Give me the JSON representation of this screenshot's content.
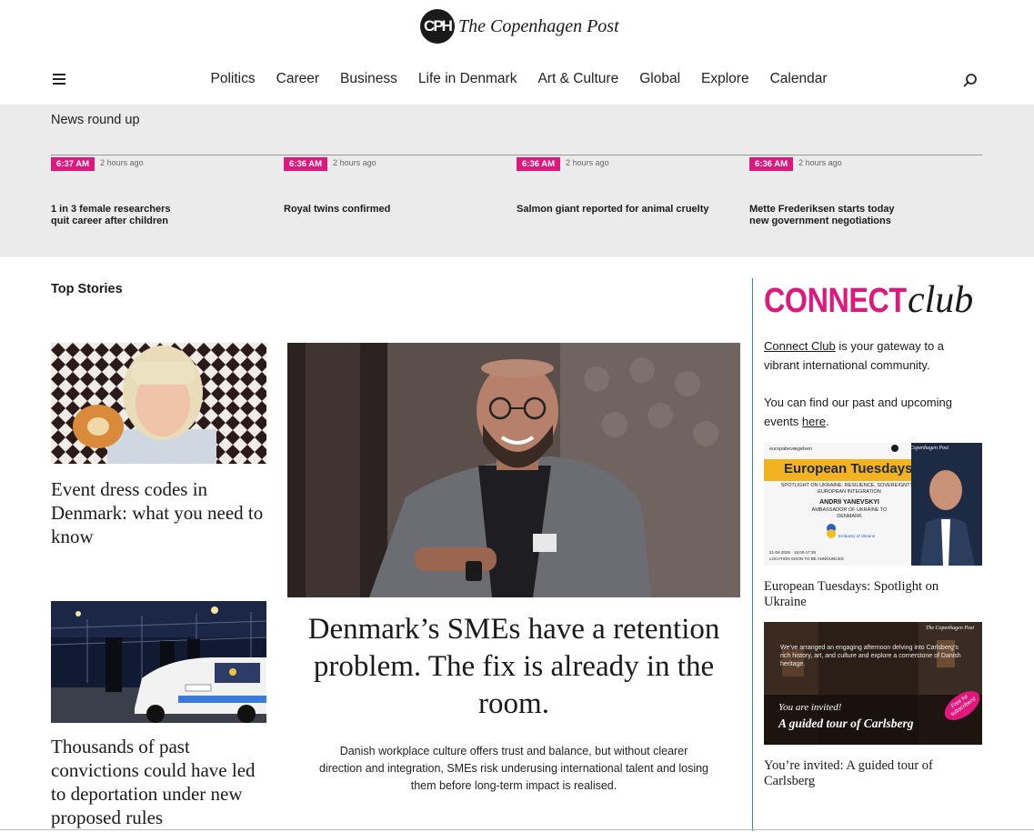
{
  "brand": {
    "mark": "CPH",
    "name": "The Copenhagen Post"
  },
  "nav": {
    "items": [
      "Politics",
      "Career",
      "Business",
      "Life in Denmark",
      "Art & Culture",
      "Global",
      "Explore",
      "Calendar"
    ]
  },
  "roundup": {
    "title": "News round up",
    "items": [
      {
        "time": "6:37 AM",
        "ago": "2 hours ago",
        "headline": "1 in 3 female researchers quit career after children"
      },
      {
        "time": "6:36 AM",
        "ago": "2 hours ago",
        "headline": "Royal twins confirmed"
      },
      {
        "time": "6:36 AM",
        "ago": "2 hours ago",
        "headline": "Salmon giant reported for animal cruelty"
      },
      {
        "time": "6:36 AM",
        "ago": "2 hours ago",
        "headline": "Mette Frederiksen starts today new government negotiations"
      }
    ]
  },
  "top_stories": {
    "heading": "Top Stories",
    "story1": {
      "title": "Event dress codes in Denmark: what you need to know"
    },
    "story2": {
      "title": "Thousands of past convictions could have led to deportation under new proposed rules"
    },
    "hero": {
      "title": "Denmark’s SMEs have a retention problem. The fix is already in the room.",
      "summary": "Danish workplace culture offers trust and balance, but without clearer direction and integration, SMEs risk underusing international talent and losing them before long-term impact is realised."
    }
  },
  "sidebar": {
    "connect_word": "CONNECT",
    "club_word": "club",
    "intro_link": "Connect Club",
    "intro_rest": " is your gateway to a vibrant international community.",
    "events_text": "You can find our past and upcoming events ",
    "events_link": "here",
    "events_end": ".",
    "promo1": {
      "brand_left": "europabevægelsen",
      "brand_right": "The Copenhagen Post",
      "title": "European Tuesdays",
      "spotlight": "SPOTLIGHT ON UKRAINE: RESILIENCE, SOVEREIGNTY & EUROPEAN INTEGRATION",
      "speaker": "ANDRII YANEVSKYI",
      "role": "AMBASSADOR OF UKRAINE TO DENMARK",
      "embassy": "Embassy of Ukraine",
      "when": "21-04-2026 · 16:00-17:30",
      "where": "LOCATION SOON TO BE ANNOUNCED",
      "caption": "European Tuesdays: Spotlight on Ukraine"
    },
    "promo2": {
      "brand": "The Copenhagen Post",
      "blurb": "We’ve arranged an engaging afternoon delving into Carlsberg’s rich history, art, and culture and explore a cornerstone of Danish heritage.",
      "invite": "You are invited!",
      "tour": "A guided tour of Carlsberg",
      "badge": "Free for subscribers!",
      "caption": "You’re invited: A guided tour of Carlsberg"
    }
  },
  "colors": {
    "accent": "#e0187d",
    "rule": "#2a8fa3",
    "band": "#ebebeb",
    "promo_gold": "#f0a81e"
  }
}
